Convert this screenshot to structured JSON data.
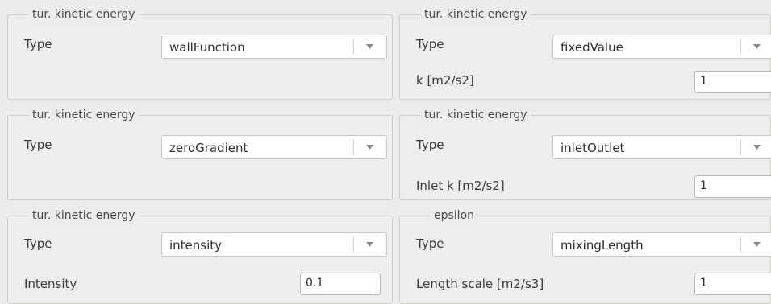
{
  "panels": [
    {
      "legend": "tur. kinetic energy",
      "type_label": "Type",
      "type_value": "wallFunction"
    },
    {
      "legend": "tur. kinetic energy",
      "type_label": "Type",
      "type_value": "fixedValue",
      "field_label": "k [m2/s2]",
      "field_value": "1"
    },
    {
      "legend": "tur. kinetic energy",
      "type_label": "Type",
      "type_value": "zeroGradient"
    },
    {
      "legend": "tur. kinetic energy",
      "type_label": "Type",
      "type_value": "inletOutlet",
      "field_label": "Inlet k [m2/s2]",
      "field_value": "1"
    },
    {
      "legend": "tur. kinetic energy",
      "type_label": "Type",
      "type_value": "intensity",
      "field_label": "Intensity",
      "field_value": "0.1"
    },
    {
      "legend": "epsilon",
      "type_label": "Type",
      "type_value": "mixingLength",
      "field_label": "Length scale [m2/s3]",
      "field_value": "1"
    }
  ],
  "icons": {
    "dropdown": "chevron-down-icon"
  }
}
